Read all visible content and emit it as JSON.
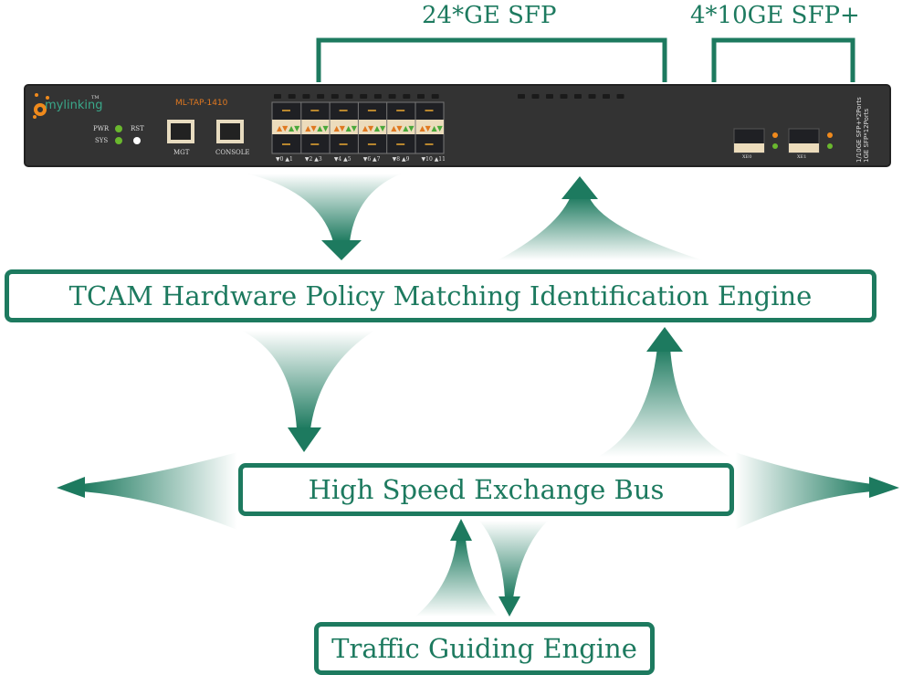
{
  "colors": {
    "accent": "#1d7a5f",
    "panel": "#333333",
    "led_green": "#6ab82e",
    "led_orange": "#f08a1c"
  },
  "brackets": {
    "ge_sfp": "24*GE SFP",
    "xge_sfp": "4*10GE SFP+"
  },
  "device": {
    "brand": "mylinking",
    "brand_tm": "TM",
    "model": "ML-TAP-1410",
    "leds": [
      "PWR",
      "SYS"
    ],
    "reset": "RST",
    "ports": {
      "mgt": "MGT",
      "console": "CONSOLE"
    },
    "sfp_labels": [
      "▼0 ▲1",
      "▼2 ▲3",
      "▼4 ▲5",
      "▼6 ▲7",
      "▼8 ▲9",
      "▼10 ▲11"
    ],
    "xe_ports": [
      "XE0",
      "XE1"
    ],
    "side_text": [
      "1/10GE SFP+*2Ports",
      "1GE SFP*12Ports"
    ]
  },
  "engines": {
    "tcam": "TCAM Hardware Policy Matching Identification Engine",
    "bus": "High Speed Exchange Bus",
    "traffic": "Traffic Guiding Engine"
  }
}
